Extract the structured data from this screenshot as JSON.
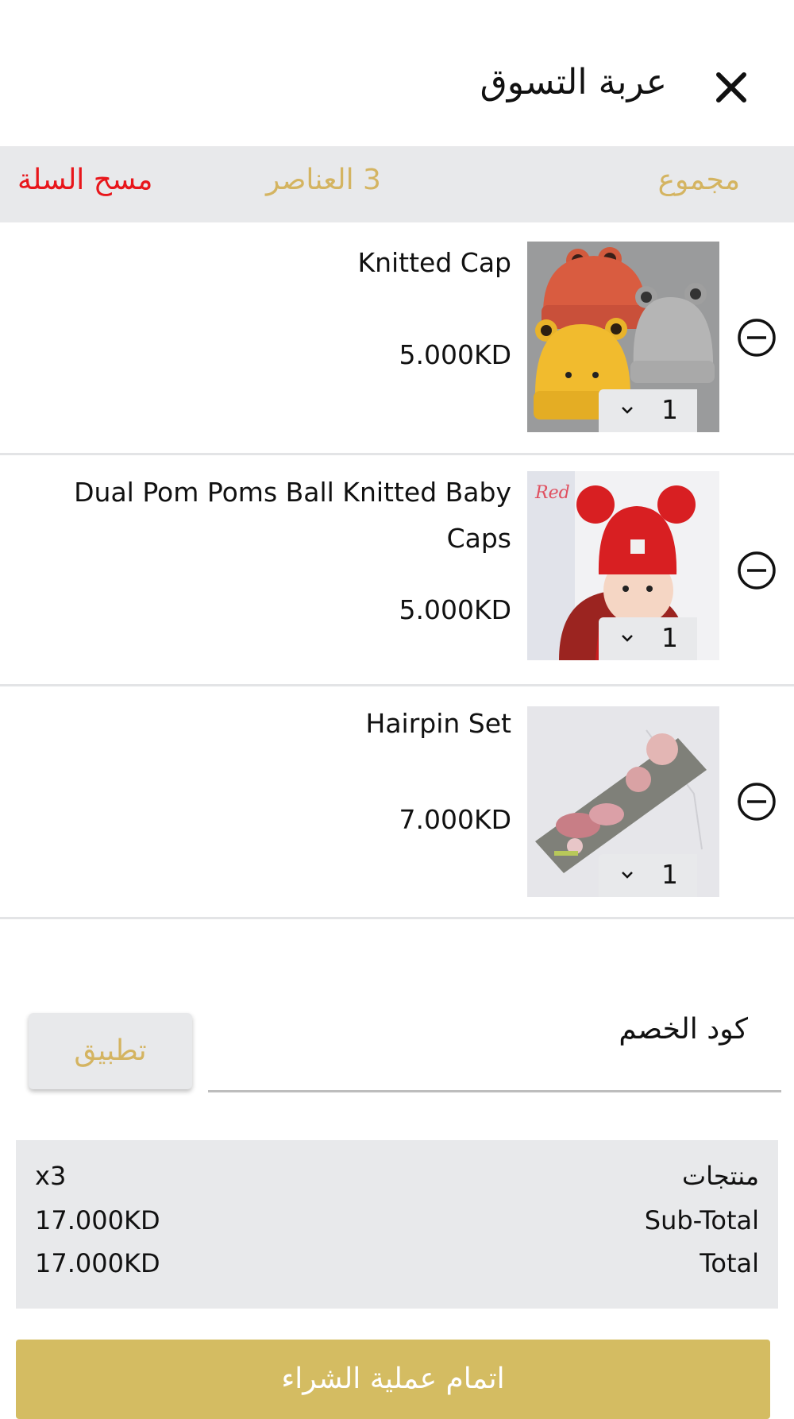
{
  "header": {
    "title": "عربة التسوق",
    "close_icon": "close-icon"
  },
  "summary_bar": {
    "total_label": "مجموع",
    "items_count": "3 العناصر",
    "clear_label": "مسح السلة"
  },
  "items": [
    {
      "name": "Knitted Cap",
      "price": "5.000KD",
      "qty": "1",
      "image": "knitted-caps-photo"
    },
    {
      "name": "Dual Pom Poms Ball Knitted Baby Caps",
      "price": "5.000KD",
      "qty": "1",
      "image": "baby-red-pompom-cap-photo"
    },
    {
      "name": "Hairpin Set",
      "price": "7.000KD",
      "qty": "1",
      "image": "hairpin-set-photo"
    }
  ],
  "coupon": {
    "label": "كود الخصم",
    "value": "",
    "apply_label": "تطبيق"
  },
  "totals": {
    "products_label": "منتجات",
    "products_value": "x3",
    "subtotal_label": "Sub-Total",
    "subtotal_value": "17.000KD",
    "total_label": "Total",
    "total_value": "17.000KD"
  },
  "checkout_label": "اتمام عملية الشراء",
  "colors": {
    "accent_gold": "#d4b461",
    "danger_red": "#e8161b",
    "panel_grey": "#e8e9eb"
  }
}
